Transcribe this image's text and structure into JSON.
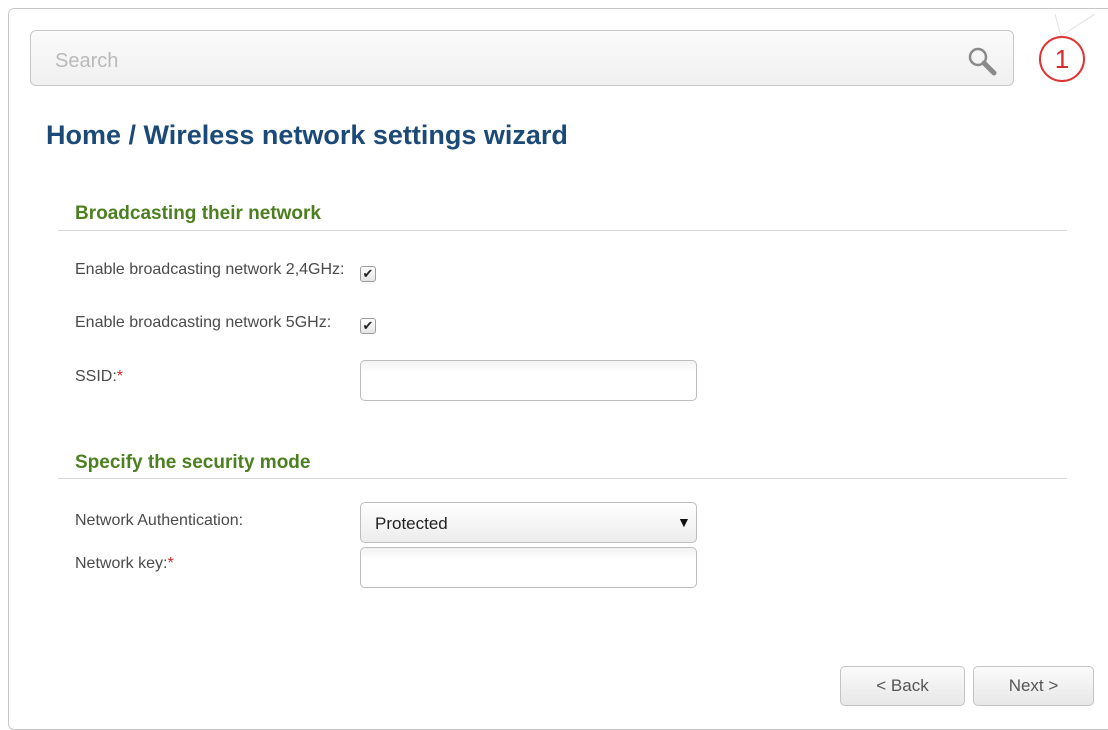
{
  "search": {
    "placeholder": "Search"
  },
  "notifications": {
    "count": "1"
  },
  "breadcrumb": {
    "home": "Home",
    "separator": " / ",
    "page": "Wireless network settings wizard"
  },
  "broadcast_section": {
    "title": "Broadcasting their network",
    "enable_24_label": "Enable broadcasting network 2,4GHz:",
    "enable_24_checked": true,
    "enable_5_label": "Enable broadcasting network 5GHz:",
    "enable_5_checked": true,
    "ssid_label": "SSID:",
    "ssid_value": ""
  },
  "security_section": {
    "title": "Specify the security mode",
    "auth_label": "Network Authentication:",
    "auth_value": "Protected",
    "key_label": "Network key:",
    "key_value": ""
  },
  "required_marker": "*",
  "buttons": {
    "back": "< Back",
    "next": "Next >"
  },
  "colors": {
    "breadcrumb": "#1b4a78",
    "section_title": "#4c7f1f",
    "required": "#d62b2b",
    "badge": "#e03333"
  },
  "icons": {
    "search": "magnifier-icon",
    "checkbox_mark": "✔",
    "select_arrow": "▼"
  }
}
